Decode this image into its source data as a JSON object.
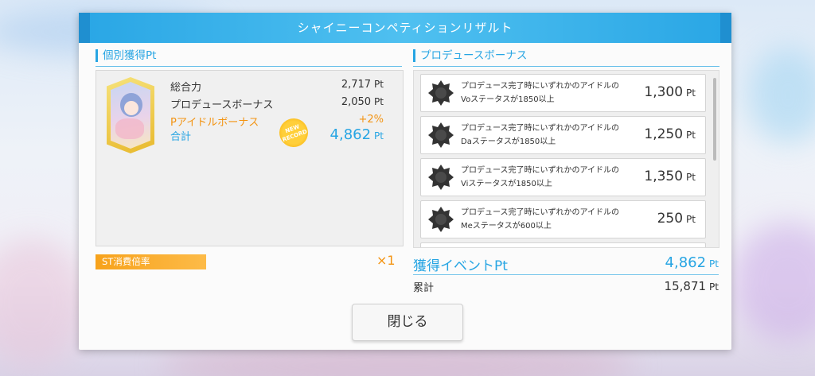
{
  "header": {
    "title": "シャイニーコンペティションリザルト"
  },
  "individual": {
    "section_title": "個別獲得Pt",
    "rows": [
      {
        "label": "総合力",
        "value": "2,717",
        "unit": "Pt"
      },
      {
        "label": "プロデュースボーナス",
        "value": "2,050",
        "unit": "Pt"
      },
      {
        "label": "Pアイドルボーナス",
        "value": "+2%",
        "unit": ""
      },
      {
        "label": "合計",
        "value": "4,862",
        "unit": "Pt"
      }
    ],
    "new_record_label": "NEW RECORD",
    "avatar_icon": "idol-card-icon"
  },
  "stamina": {
    "label": "ST消費倍率",
    "multiplier": "×1"
  },
  "produce_bonus": {
    "section_title": "プロデュースボーナス",
    "items": [
      {
        "line1": "プロデュース完了時にいずれかのアイドルの",
        "line2": "Voステータスが1850以上",
        "value": "1,300",
        "unit": "Pt"
      },
      {
        "line1": "プロデュース完了時にいずれかのアイドルの",
        "line2": "Daステータスが1850以上",
        "value": "1,250",
        "unit": "Pt"
      },
      {
        "line1": "プロデュース完了時にいずれかのアイドルの",
        "line2": "Viステータスが1850以上",
        "value": "1,350",
        "unit": "Pt"
      },
      {
        "line1": "プロデュース完了時にいずれかのアイドルの",
        "line2": "Meステータスが600以上",
        "value": "250",
        "unit": "Pt"
      }
    ],
    "item_icon": "dark-badge-icon"
  },
  "event": {
    "label": "獲得イベントPt",
    "value": "4,862",
    "unit": "Pt"
  },
  "total": {
    "label": "累計",
    "value": "15,871",
    "unit": "Pt"
  },
  "close_button": {
    "label": "閉じる"
  },
  "colors": {
    "accent": "#27a5e3",
    "highlight": "#f39311"
  }
}
